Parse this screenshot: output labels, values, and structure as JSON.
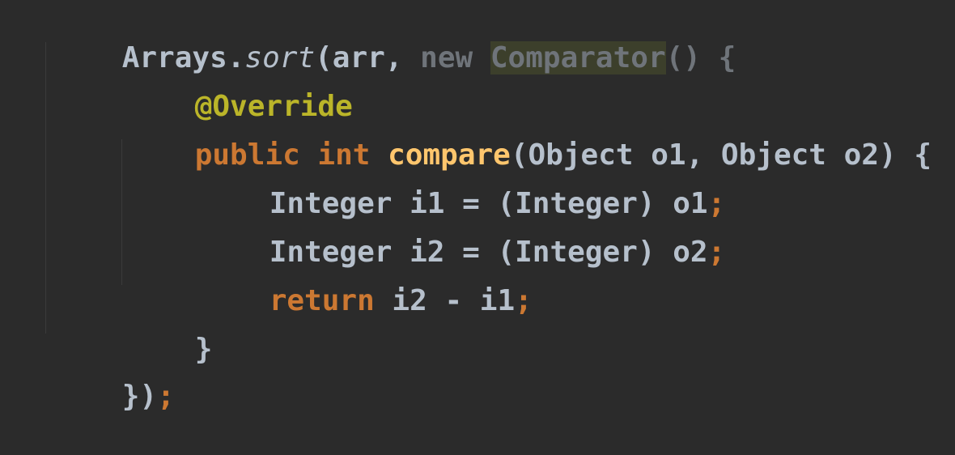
{
  "editor": {
    "colors": {
      "background": "#2b2b2b",
      "default_text": "#b6c0cc",
      "keyword": "#cc7832",
      "method_declaration": "#ffc66d",
      "annotation": "#bbb529",
      "dimmed_text": "#6f747a",
      "highlight_background": "#3c3f2b"
    },
    "lines": [
      {
        "tokens": [
          {
            "text": "Arrays."
          },
          {
            "text": "sort"
          },
          {
            "text": "(arr, "
          },
          {
            "text": "new "
          },
          {
            "text": "Comparator"
          },
          {
            "text": "() {"
          }
        ]
      },
      {
        "tokens": [
          {
            "text": "@Override"
          }
        ]
      },
      {
        "tokens": [
          {
            "text": "public int "
          },
          {
            "text": "compare"
          },
          {
            "text": "(Object o1, Object o2) {"
          }
        ]
      },
      {
        "tokens": [
          {
            "text": "Integer i1 = (Integer) o1"
          },
          {
            "text": ";"
          }
        ]
      },
      {
        "tokens": [
          {
            "text": "Integer i2 = (Integer) o2"
          },
          {
            "text": ";"
          }
        ]
      },
      {
        "tokens": [
          {
            "text": "return "
          },
          {
            "text": "i2 - i1"
          },
          {
            "text": ";"
          }
        ]
      },
      {
        "tokens": [
          {
            "text": "}"
          }
        ]
      },
      {
        "tokens": [
          {
            "text": "})"
          },
          {
            "text": ";"
          }
        ]
      }
    ]
  }
}
